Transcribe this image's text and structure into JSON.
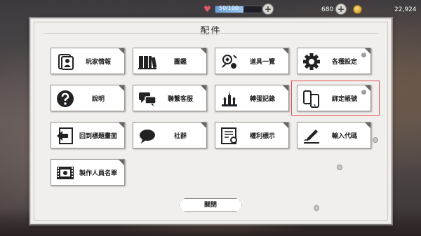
{
  "hud": {
    "hp_text": "50/100",
    "hp_fraction": 0.6,
    "gems": "680",
    "coins": "22,924"
  },
  "panel": {
    "title": "配件"
  },
  "menu": [
    {
      "label": "玩家情報",
      "icon": "player-card-icon"
    },
    {
      "label": "圖鑑",
      "icon": "books-icon"
    },
    {
      "label": "道具一覽",
      "icon": "items-icon"
    },
    {
      "label": "各種設定",
      "icon": "gear-icon",
      "badge": "!"
    },
    {
      "label": "說明",
      "icon": "question-icon"
    },
    {
      "label": "聯繫客服",
      "icon": "chat-bubbles-icon"
    },
    {
      "label": "轉蛋記錄",
      "icon": "castle-icon"
    },
    {
      "label": "綁定帳號",
      "icon": "phones-icon",
      "badge": "!"
    },
    {
      "label": "回到標題畫面",
      "icon": "return-icon"
    },
    {
      "label": "社群",
      "icon": "speech-bubble-icon"
    },
    {
      "label": "權利標示",
      "icon": "certificate-icon"
    },
    {
      "label": "輸入代碼",
      "icon": "pen-signing-icon"
    },
    {
      "label": "製作人員名單",
      "icon": "film-strip-icon"
    }
  ],
  "close_label": "關閉",
  "colors": {
    "highlight": "#e05050",
    "hp": "#6aa0d8"
  }
}
